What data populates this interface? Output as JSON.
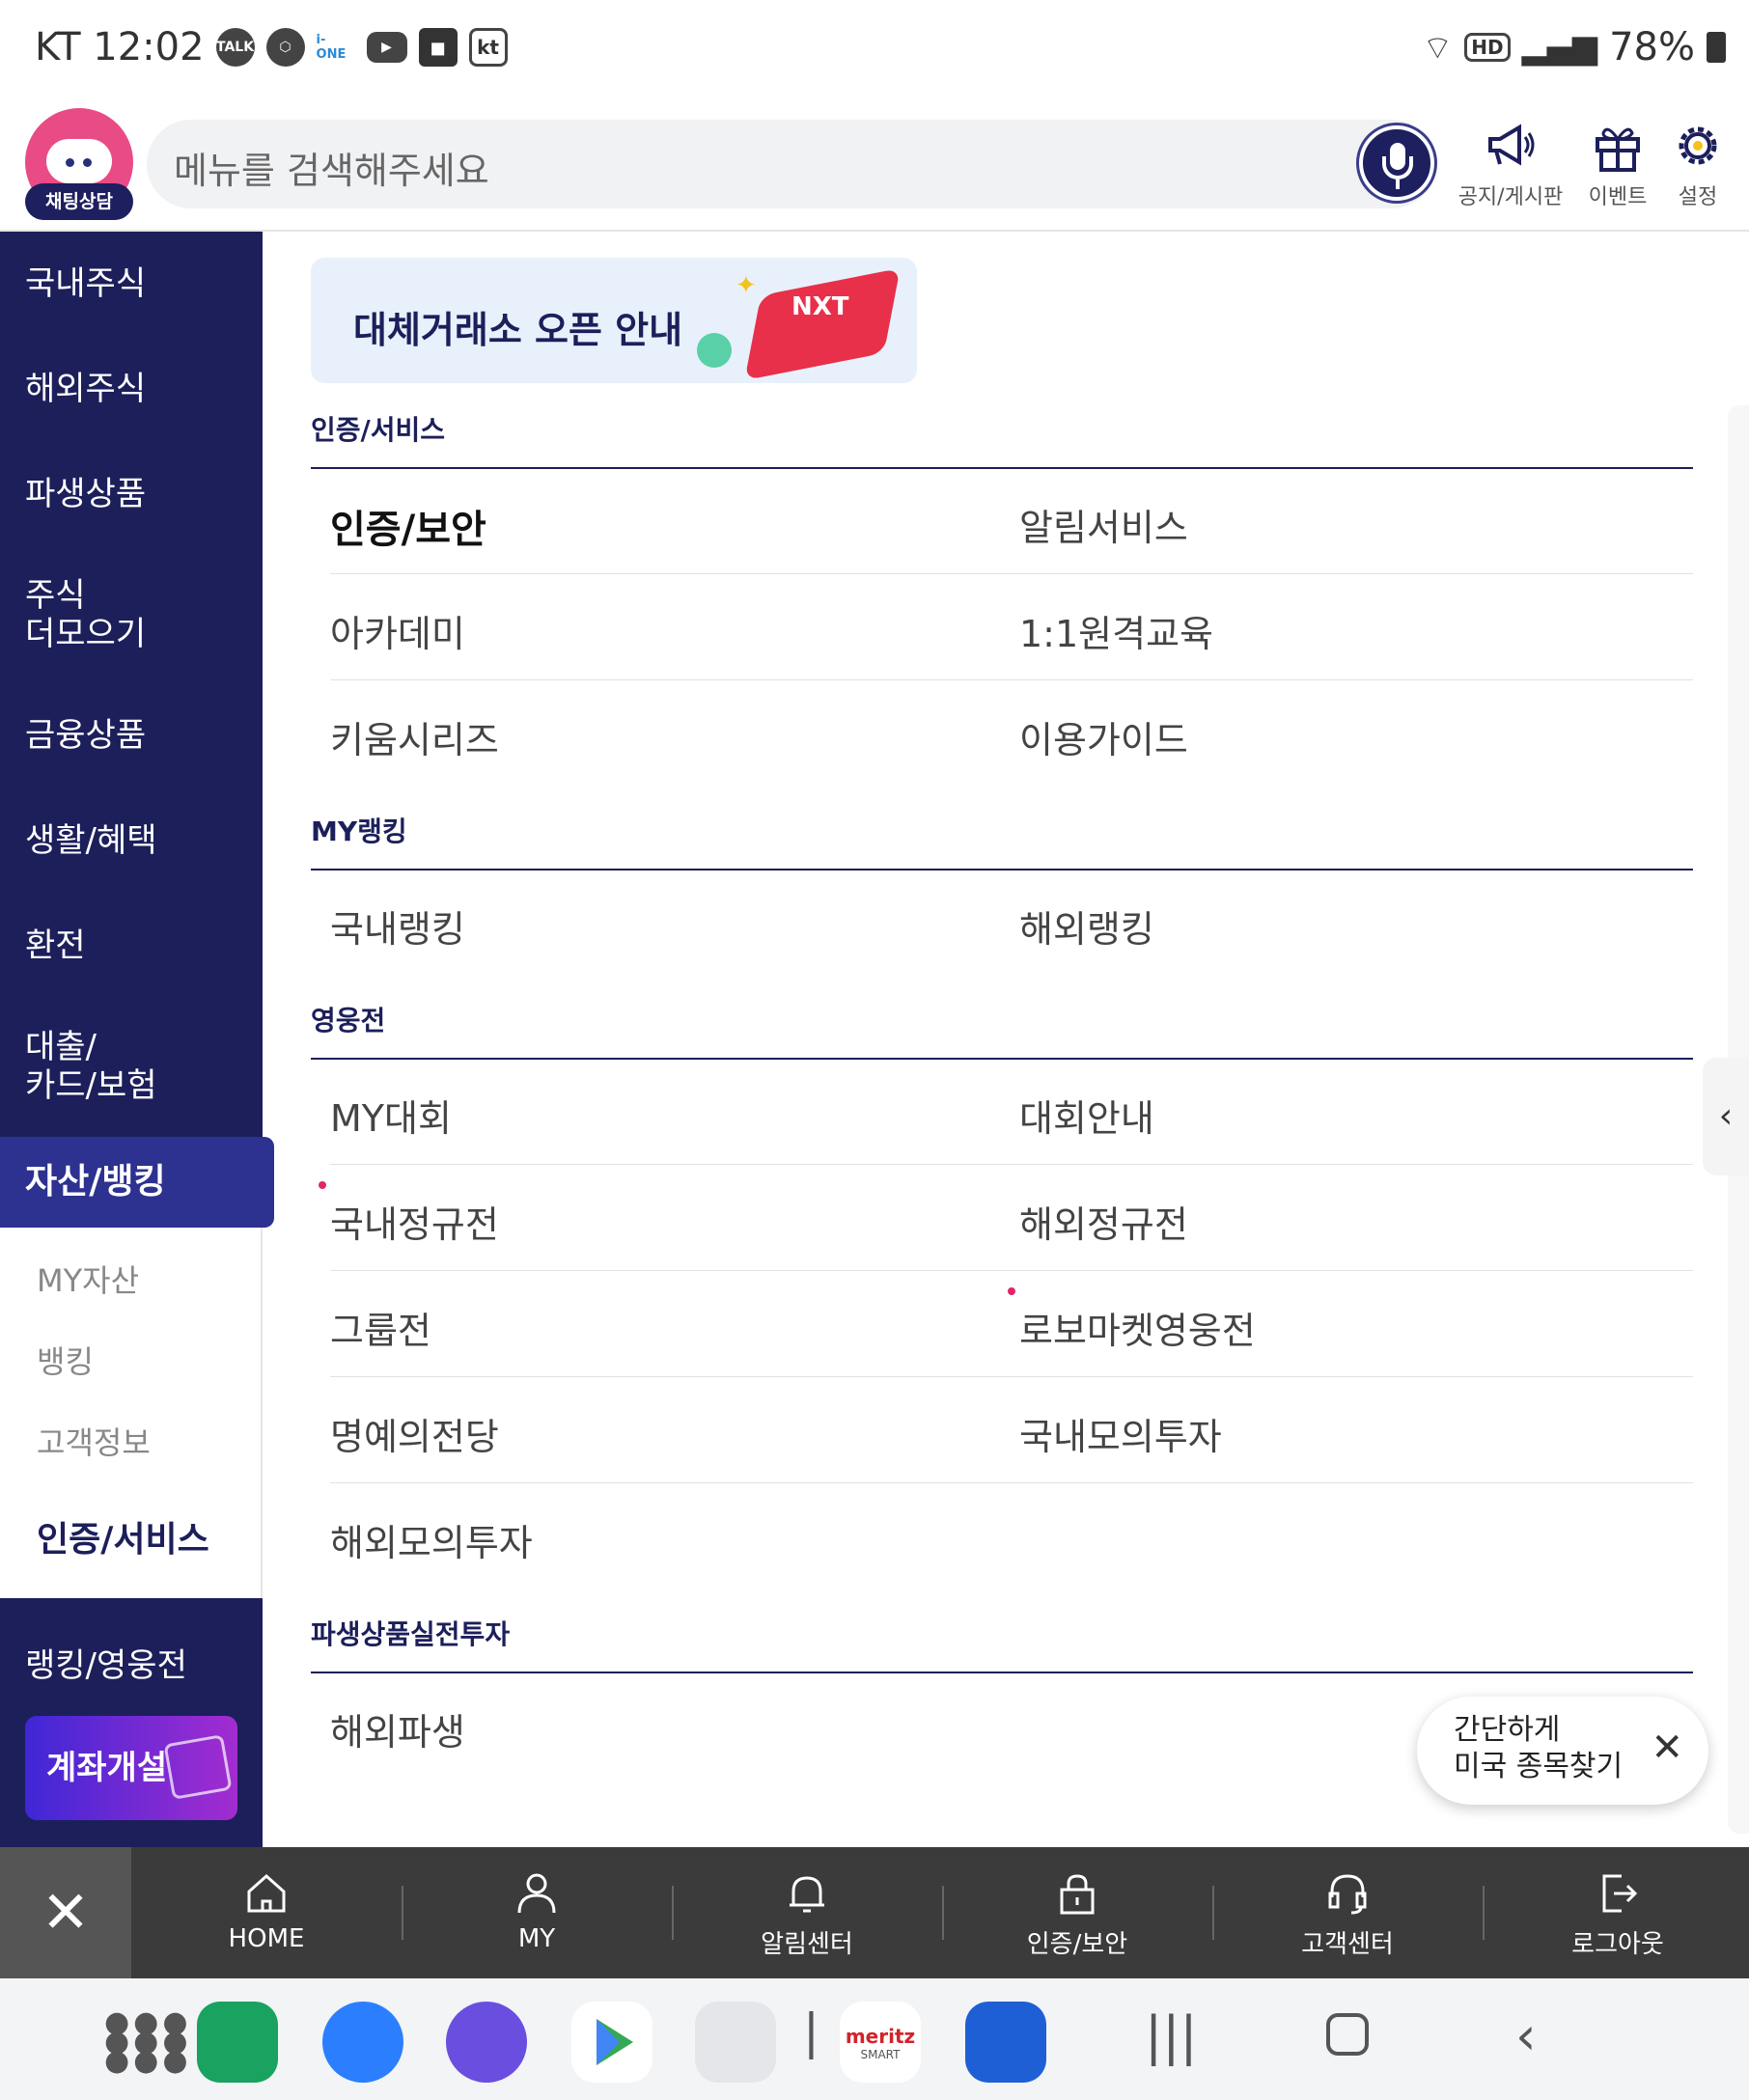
{
  "status_bar": {
    "carrier_time": "KT 12:02",
    "icons": [
      "talk-icon",
      "hexagon-app-icon",
      "i-one-icon",
      "youtube-icon",
      "shopping-bag-icon",
      "kt-icon"
    ],
    "talk_label": "TALK",
    "ione_label": "i-ONE",
    "kt_label": "kt",
    "hd_label": "HD",
    "battery": "78%"
  },
  "header": {
    "chatbot_label": "채팅상담",
    "search_placeholder": "메뉴를 검색해주세요",
    "notice_label": "공지/게시판",
    "event_label": "이벤트",
    "settings_label": "설정"
  },
  "sidebar": {
    "items": [
      {
        "label": "국내주식"
      },
      {
        "label": "해외주식"
      },
      {
        "label": "파생상품"
      },
      {
        "label": "주식\n더모으기"
      },
      {
        "label": "금융상품"
      },
      {
        "label": "생활/혜택"
      },
      {
        "label": "환전"
      },
      {
        "label": "대출/\n카드/보험"
      }
    ],
    "active": "자산/뱅킹",
    "sub_items": [
      "MY자산",
      "뱅킹",
      "고객정보",
      "인증/서비스"
    ],
    "after": "랭킹/영웅전",
    "open_account": "계좌개설"
  },
  "banner": {
    "text": "대체거래소 오픈 안내",
    "logo_text": "NXT"
  },
  "sections": [
    {
      "title": "인증/서비스",
      "rows": [
        [
          "인증/보안",
          "알림서비스"
        ],
        [
          "아카데미",
          "1:1원격교육"
        ],
        [
          "키움시리즈",
          "이용가이드"
        ]
      ]
    },
    {
      "title": "MY랭킹",
      "rows": [
        [
          "국내랭킹",
          "해외랭킹"
        ]
      ]
    },
    {
      "title": "영웅전",
      "rows": [
        [
          "MY대회",
          "대회안내"
        ],
        [
          "국내정규전",
          "해외정규전"
        ],
        [
          "그룹전",
          "로보마켓영웅전"
        ],
        [
          "명예의전당",
          "국내모의투자"
        ],
        [
          "해외모의투자",
          ""
        ]
      ]
    },
    {
      "title": "파생상품실전투자",
      "rows": [
        [
          "해외파생",
          ""
        ]
      ]
    }
  ],
  "toast": {
    "line1": "간단하게",
    "line2": "미국 종목찾기"
  },
  "bottom_nav": [
    "HOME",
    "MY",
    "알림센터",
    "인증/보안",
    "고객센터",
    "로그아웃"
  ],
  "dock": {
    "apps": [
      "apps-grid-icon",
      "phone-app-icon",
      "messages-app-icon",
      "internet-app-icon",
      "play-store-icon",
      "folder-icon",
      "meritz-smart-icon",
      "kiwoom-app-icon"
    ],
    "meritz_label": "meritz",
    "meritz_sub": "SMART"
  },
  "colors": {
    "navy": "#1c1f5a",
    "active_menu": "#2d3190",
    "accent_pink": "#e0266b"
  }
}
